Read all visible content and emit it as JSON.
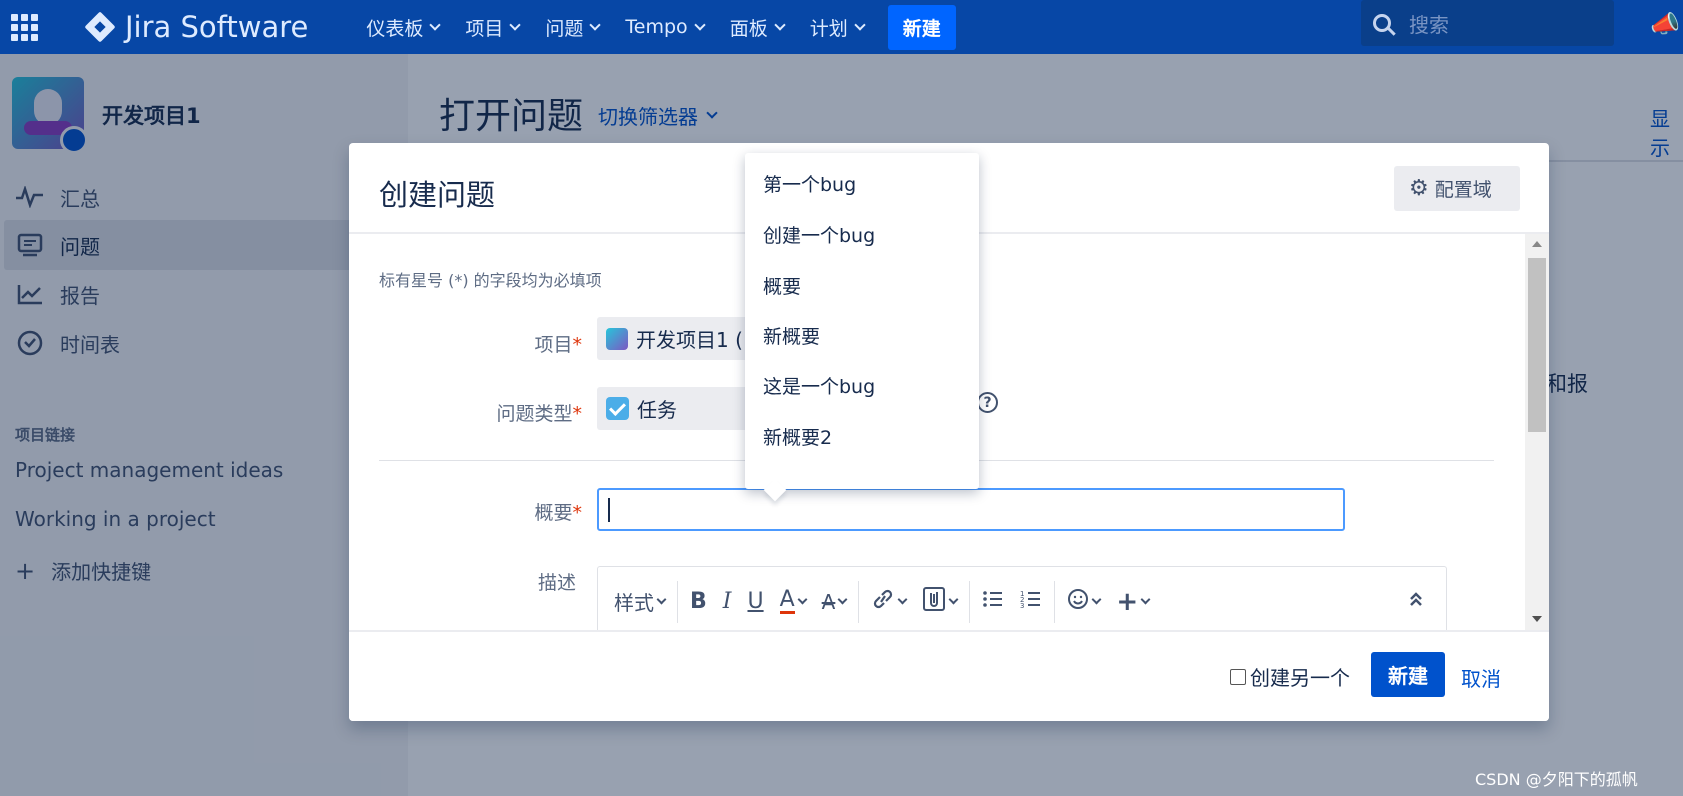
{
  "topbar": {
    "product": "Jira Software",
    "nav": [
      {
        "label": "仪表板"
      },
      {
        "label": "项目"
      },
      {
        "label": "问题"
      },
      {
        "label": "Tempo"
      },
      {
        "label": "面板"
      },
      {
        "label": "计划"
      }
    ],
    "create_label": "新建",
    "search_placeholder": "搜索"
  },
  "sidebar": {
    "project_name": "开发项目1",
    "items": [
      {
        "label": "汇总",
        "icon": "pulse-icon"
      },
      {
        "label": "问题",
        "icon": "issues-icon",
        "active": true
      },
      {
        "label": "报告",
        "icon": "chart-icon"
      },
      {
        "label": "时间表",
        "icon": "clock-icon"
      }
    ],
    "links_heading": "项目链接",
    "links": [
      "Project management ideas",
      "Working in a project"
    ],
    "add_shortcut": "添加快捷键"
  },
  "main": {
    "title": "打开问题",
    "switch_filter": "切换筛选器",
    "right_cut": "显示",
    "peek_text": "和报"
  },
  "dialog": {
    "title": "创建问题",
    "config_label": "配置域",
    "required_note": "标有星号 (*) 的字段均为必填项",
    "fields": {
      "project_label": "项目",
      "project_value": "开发项目1 (",
      "issue_type_label": "问题类型",
      "issue_type_value": "任务",
      "summary_label": "概要",
      "description_label": "描述",
      "required_mark": "*"
    },
    "toolbar": {
      "style_label": "样式",
      "bold": "B",
      "italic": "I",
      "underline": "U",
      "text_color": "A",
      "text_effects": "A"
    },
    "footer": {
      "create_another": "创建另一个",
      "create_label": "新建",
      "cancel_label": "取消"
    }
  },
  "autocomplete": {
    "items": [
      "第一个bug",
      "创建一个bug",
      "概要",
      "新概要",
      "这是一个bug",
      "新概要2"
    ]
  },
  "watermark": "CSDN @夕阳下的孤帆",
  "colors": {
    "nav_bg": "#0747a6",
    "primary": "#0052cc",
    "required": "#de350b",
    "focus": "#4c9aff"
  }
}
